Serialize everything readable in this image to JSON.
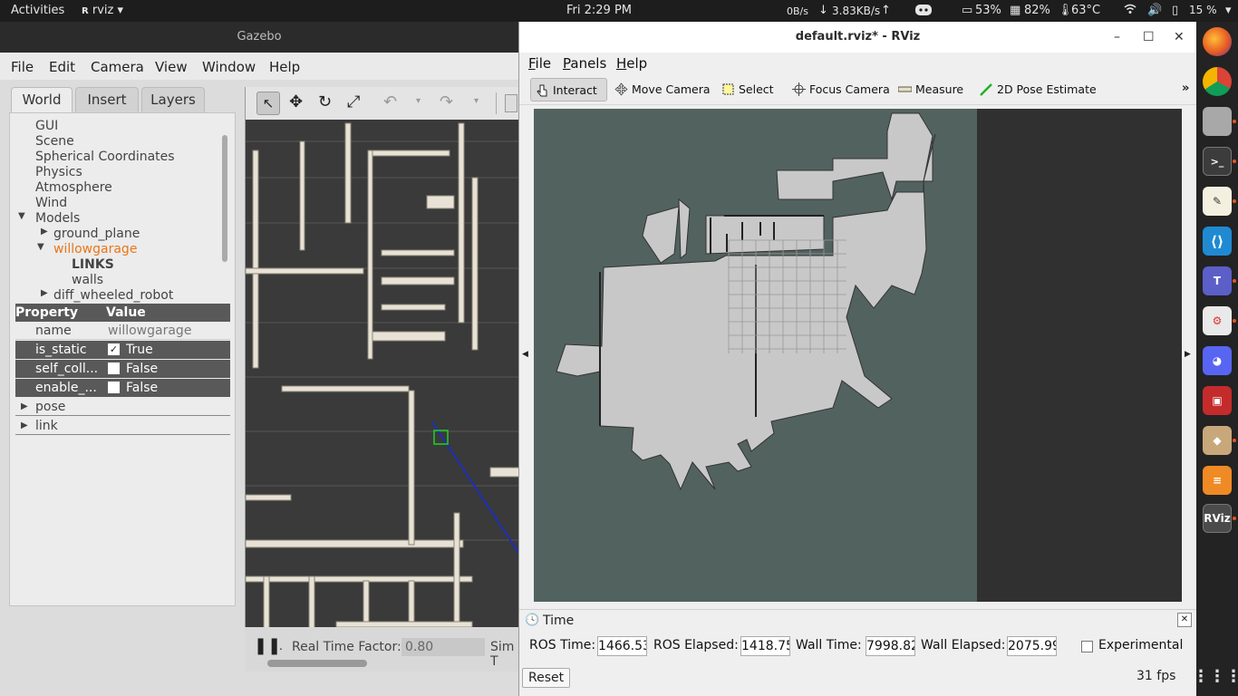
{
  "topbar": {
    "activities": "Activities",
    "app_name": "rviz",
    "clock": "Fri  2:29 PM",
    "net_up": "0B/s",
    "net_down": "3.83KB/s",
    "cpu": "53%",
    "memory": "82%",
    "temp": "63°C",
    "battery": "15 %"
  },
  "gazebo": {
    "title": "Gazebo",
    "menu": [
      "File",
      "Edit",
      "Camera",
      "View",
      "Window",
      "Help"
    ],
    "tabs": [
      "World",
      "Insert",
      "Layers"
    ],
    "tree": {
      "gui": "GUI",
      "scene": "Scene",
      "spherical": "Spherical Coordinates",
      "physics": "Physics",
      "atmosphere": "Atmosphere",
      "wind": "Wind",
      "models": "Models",
      "ground_plane": "ground_plane",
      "willowgarage": "willowgarage",
      "links": "LINKS",
      "walls": "walls",
      "robot": "diff_wheeled_robot"
    },
    "props": {
      "h_property": "Property",
      "h_value": "Value",
      "name_k": "name",
      "name_v": "willowgarage",
      "static_k": "is_static",
      "static_v": "True",
      "selfcoll_k": "self_coll...",
      "selfcoll_v": "False",
      "enable_k": "enable_...",
      "enable_v": "False",
      "pose": "pose",
      "link": "link"
    },
    "bottom": {
      "rtf_label": "Real Time Factor:",
      "rtf_value": "0.80",
      "sim_label": "Sim T"
    }
  },
  "rviz": {
    "title": "default.rviz* - RViz",
    "menu": [
      "File",
      "Panels",
      "Help"
    ],
    "tools": [
      "Interact",
      "Move Camera",
      "Select",
      "Focus Camera",
      "Measure",
      "2D Pose Estimate"
    ],
    "time": {
      "header": "Time",
      "ros_time_label": "ROS Time:",
      "ros_time": "1466.53",
      "ros_elapsed_label": "ROS Elapsed:",
      "ros_elapsed": "1418.75",
      "wall_time_label": "Wall Time:",
      "wall_time": "7998.82",
      "wall_elapsed_label": "Wall Elapsed:",
      "wall_elapsed": "2075.99",
      "experimental": "Experimental",
      "reset": "Reset",
      "fps": "31 fps"
    }
  },
  "colors": {
    "map_background": "#52625f",
    "map_free": "#c8c8c8",
    "selected_model": "#e9761a"
  }
}
